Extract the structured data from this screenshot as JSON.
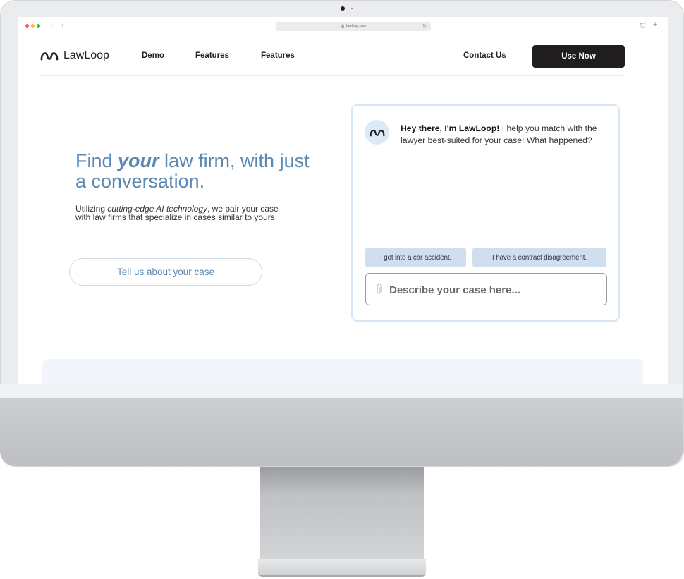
{
  "browser": {
    "url": "lawloop.com",
    "icons": [
      "lock-icon",
      "reload-icon",
      "share-icon",
      "new-tab-icon",
      "back-icon",
      "forward-icon"
    ]
  },
  "header": {
    "brand": "LawLoop",
    "nav": [
      "Demo",
      "Features",
      "Features"
    ],
    "contact": "Contact Us",
    "cta": "Use Now"
  },
  "hero": {
    "title_pre": "Find ",
    "title_em": "your",
    "title_post": " law firm, with just a conversation.",
    "sub_pre": "Utilizing ",
    "sub_em": "cutting-edge AI technology",
    "sub_post": ", we pair your case with law firms that specialize in cases similar to yours.",
    "button": "Tell us about your case"
  },
  "chat": {
    "greeting_bold": "Hey there, I'm LawLoop!",
    "greeting_rest": " I help you match with the lawyer best-suited for your case! What happened?",
    "suggestions": [
      "I got into a car accident.",
      "I have a contract disagreement."
    ],
    "input_placeholder": "Describe your case here..."
  },
  "colors": {
    "accent": "#5b88b3",
    "chip_bg": "#cfdfef",
    "cta_bg": "#1f1d1d",
    "panel_border": "#d9e6f3"
  }
}
